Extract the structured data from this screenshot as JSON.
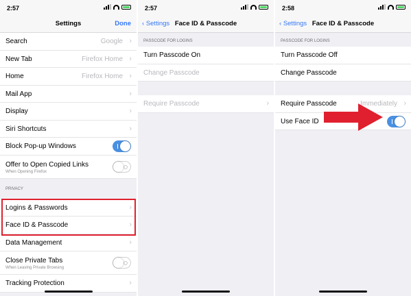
{
  "accent_color": "#3478f6",
  "highlight_color": "#e0202e",
  "screens": {
    "settings": {
      "time": "2:57",
      "title": "Settings",
      "done_label": "Done",
      "rows": [
        {
          "label": "Search",
          "value": "Google"
        },
        {
          "label": "New Tab",
          "value": "Firefox Home"
        },
        {
          "label": "Home",
          "value": "Firefox Home"
        },
        {
          "label": "Mail App",
          "value": ""
        },
        {
          "label": "Display",
          "value": ""
        },
        {
          "label": "Siri Shortcuts",
          "value": ""
        }
      ],
      "block_popups": {
        "label": "Block Pop-up Windows",
        "on": true
      },
      "offer_copied": {
        "label": "Offer to Open Copied Links",
        "sublabel": "When Opening Firefox",
        "on": false
      },
      "privacy_header": "PRIVACY",
      "privacy_rows": [
        {
          "label": "Logins & Passwords"
        },
        {
          "label": "Face ID & Passcode"
        },
        {
          "label": "Data Management"
        }
      ],
      "close_private": {
        "label": "Close Private Tabs",
        "sublabel": "When Leaving Private Browsing",
        "on": false
      },
      "tracking": {
        "label": "Tracking Protection"
      }
    },
    "passcode_off": {
      "time": "2:57",
      "back_label": "Settings",
      "title": "Face ID & Passcode",
      "section_header": "PASSCODE FOR LOGINS",
      "turn_on_label": "Turn Passcode On",
      "change_label": "Change Passcode",
      "require_label": "Require Passcode"
    },
    "passcode_on": {
      "time": "2:58",
      "back_label": "Settings",
      "title": "Face ID & Passcode",
      "section_header": "PASSCODE FOR LOGINS",
      "turn_off_label": "Turn Passcode Off",
      "change_label": "Change Passcode",
      "require_label": "Require Passcode",
      "require_value": "Immediately",
      "face_id_label": "Use Face ID",
      "face_id_on": true
    }
  }
}
